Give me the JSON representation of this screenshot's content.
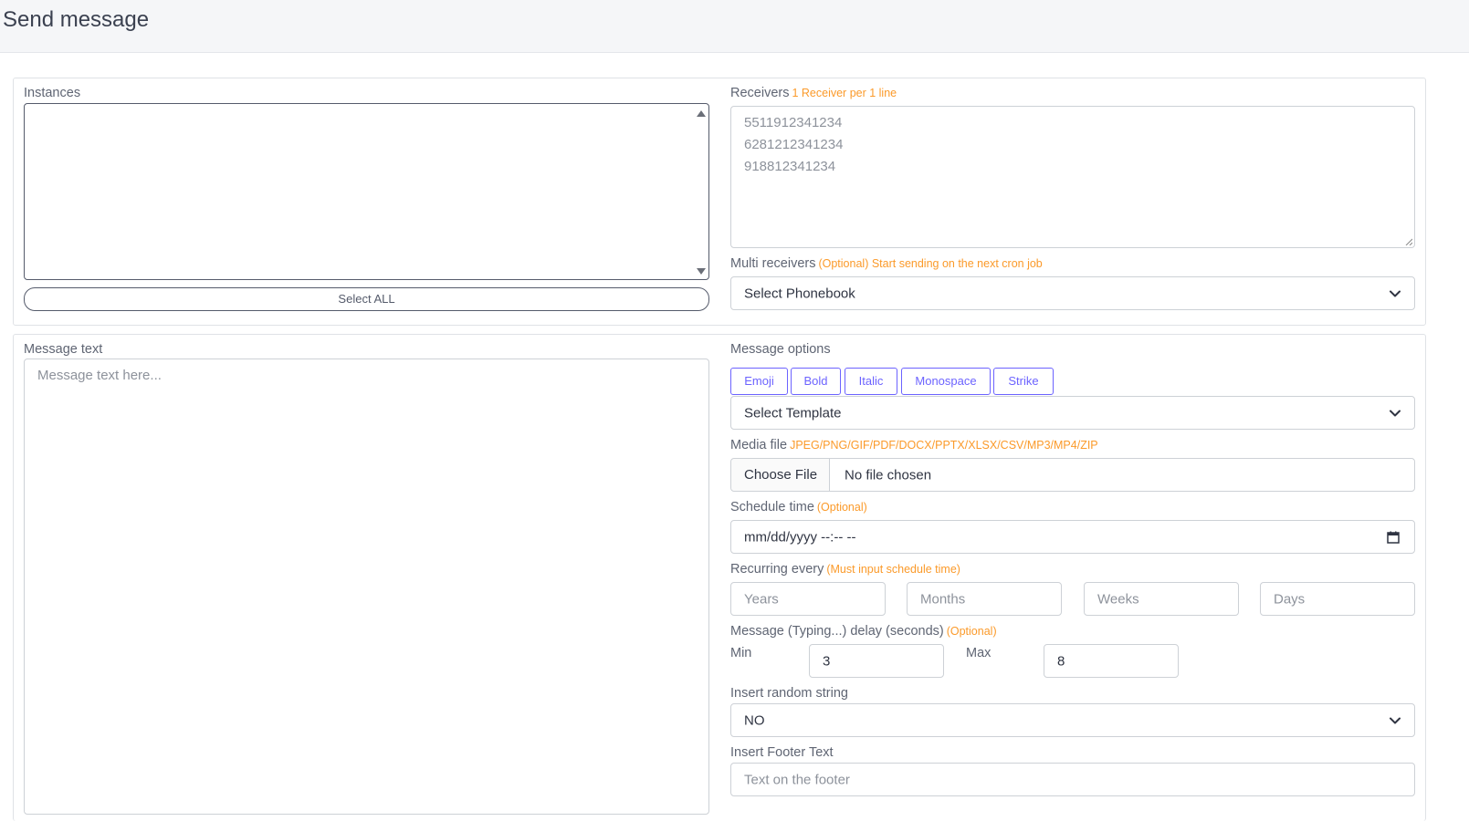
{
  "page": {
    "title": "Send message"
  },
  "instances": {
    "label": "Instances",
    "select_all_label": "Select ALL"
  },
  "receivers": {
    "label": "Receivers",
    "hint": "1 Receiver per 1 line",
    "placeholder_lines": [
      "5511912341234",
      "6281212341234",
      "918812341234"
    ]
  },
  "multi_receivers": {
    "label": "Multi receivers",
    "hint": "(Optional) Start sending on the next cron job",
    "selected": "Select Phonebook"
  },
  "message_text": {
    "label": "Message text",
    "placeholder": "Message text here..."
  },
  "message_options": {
    "label": "Message options",
    "buttons": [
      "Emoji",
      "Bold",
      "Italic",
      "Monospace",
      "Strike"
    ],
    "template_selected": "Select Template"
  },
  "media_file": {
    "label": "Media file",
    "hint": "JPEG/PNG/GIF/PDF/DOCX/PPTX/XLSX/CSV/MP3/MP4/ZIP",
    "choose_label": "Choose File",
    "status": "No file chosen"
  },
  "schedule": {
    "label": "Schedule time",
    "hint": "(Optional)",
    "value": "mm/dd/yyyy --:-- --"
  },
  "recurring": {
    "label": "Recurring every",
    "hint": "(Must input schedule time)",
    "placeholders": [
      "Years",
      "Months",
      "Weeks",
      "Days"
    ]
  },
  "delay": {
    "label": "Message (Typing...) delay (seconds)",
    "hint": "(Optional)",
    "min_label": "Min",
    "min_value": "3",
    "max_label": "Max",
    "max_value": "8"
  },
  "random_string": {
    "label": "Insert random string",
    "selected": "NO"
  },
  "footer_text": {
    "label": "Insert Footer Text",
    "placeholder": "Text on the footer"
  },
  "colors": {
    "hint": "#fb9a2a",
    "format_button": "#6c63ff"
  },
  "icons": {
    "dropdown": "chevron-down-icon",
    "calendar": "calendar-icon"
  }
}
